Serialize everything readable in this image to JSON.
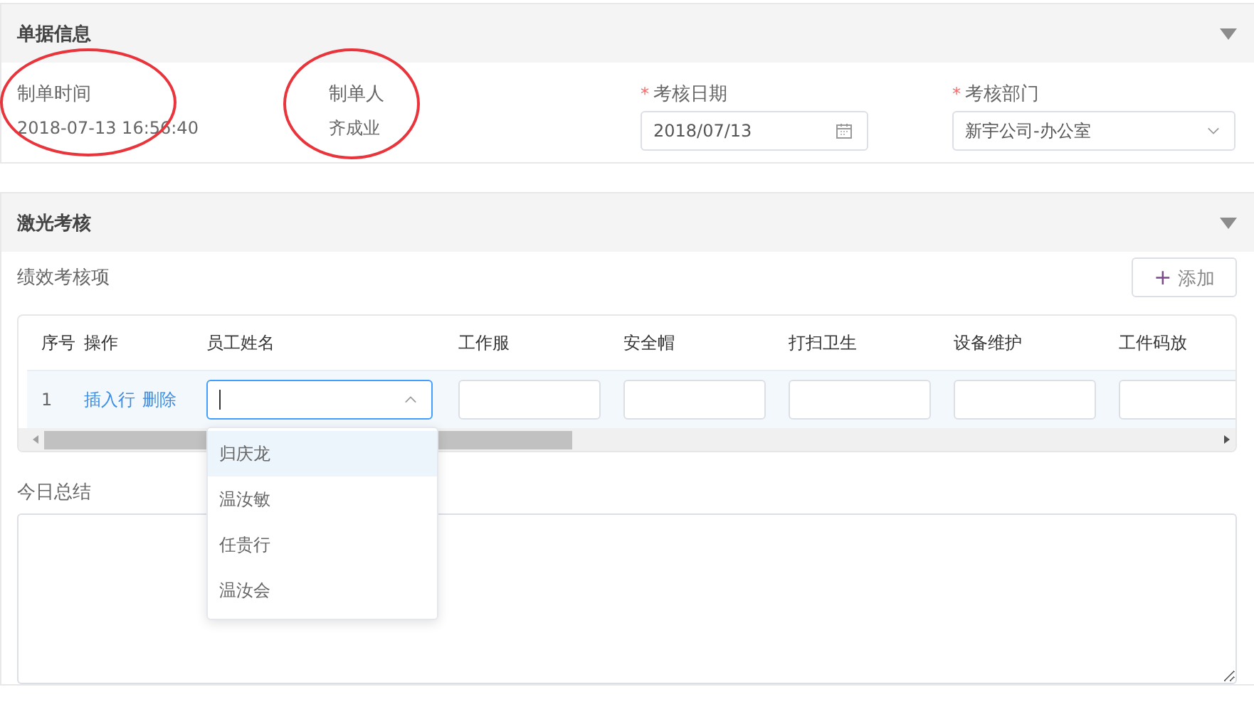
{
  "bill_info": {
    "title": "单据信息",
    "fields": [
      {
        "kind": "text",
        "label": "制单时间",
        "value": "2018-07-13 16:56:40",
        "circled": true
      },
      {
        "kind": "text",
        "label": "制单人",
        "value": "齐成业",
        "circled": true
      },
      {
        "kind": "date",
        "required_mark": "*",
        "label": "考核日期",
        "value": "2018/07/13",
        "circled": false
      },
      {
        "kind": "select",
        "required_mark": "*",
        "label": "考核部门",
        "value": "新宇公司-办公室",
        "circled": false
      }
    ]
  },
  "laser_review": {
    "title": "激光考核",
    "subtitle": "绩效考核项",
    "add_button": {
      "icon": "+",
      "label": "添加"
    },
    "table": {
      "columns": [
        "序号",
        "操作",
        "员工姓名",
        "工作服",
        "安全帽",
        "打扫卫生",
        "设备维护",
        "工件码放"
      ],
      "rows": [
        {
          "index": "1",
          "actions": [
            "插入行",
            "删除"
          ],
          "employee": {
            "focused": true,
            "open": true,
            "options": [
              {
                "label": "归庆龙",
                "selected": true
              },
              {
                "label": "温汝敏",
                "selected": false
              },
              {
                "label": "任贵行",
                "selected": false
              },
              {
                "label": "温汝会",
                "selected": false
              }
            ]
          }
        }
      ]
    },
    "summary": {
      "label": "今日总结"
    }
  }
}
